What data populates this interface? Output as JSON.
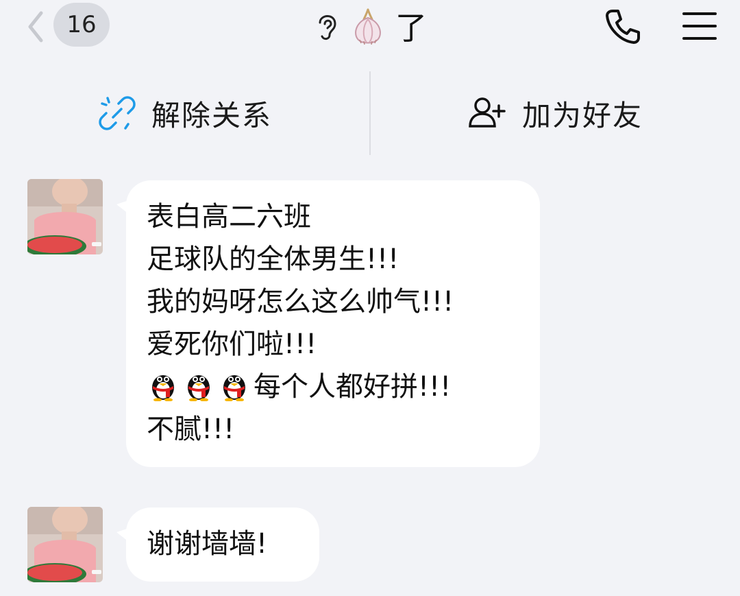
{
  "header": {
    "unread_count": "16",
    "title": "了",
    "back_icon": "chevron-left-icon",
    "phone_icon": "phone-icon",
    "menu_icon": "menu-icon"
  },
  "actions": {
    "unlink_label": "解除关系",
    "add_friend_label": "加为好友"
  },
  "messages": [
    {
      "lines": [
        "表白高二六班",
        "足球队的全体男生!!!",
        "我的妈呀怎么这么帅气!!!",
        "爱死你们啦!!!",
        "每个人都好拼!!!",
        "不腻!!!"
      ]
    },
    {
      "lines": [
        "谢谢墙墙!"
      ]
    }
  ],
  "colors": {
    "background": "#f2f3f7",
    "bubble": "#ffffff",
    "accent_link": "#1e9be8",
    "badge": "#d9dbe1"
  }
}
